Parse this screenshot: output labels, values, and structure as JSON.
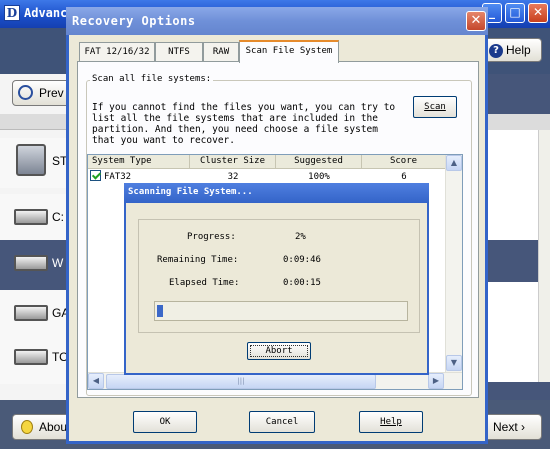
{
  "main_window": {
    "title": "Advanc",
    "icon_letter": "D",
    "help_label": "Help",
    "prev_label": "Prev",
    "about_label": "Abou",
    "next_label": "Next",
    "drives": [
      {
        "label": "ST"
      },
      {
        "label": "C:"
      },
      {
        "label": "W"
      },
      {
        "label": "GA"
      },
      {
        "label": "TO"
      }
    ]
  },
  "recovery_dialog": {
    "title": "Recovery Options",
    "tabs": [
      {
        "label": "FAT 12/16/32"
      },
      {
        "label": "NTFS"
      },
      {
        "label": "RAW"
      },
      {
        "label": "Scan File System"
      }
    ],
    "active_tab": "Scan File System",
    "group_title": "Scan all file systems:",
    "description": "If you cannot find the files you want, you can try to list all the file systems that are included in the partition. And then, you need choose a file system that you want to recover.",
    "scan_button": "Scan",
    "table": {
      "columns": [
        "System Type",
        "Cluster Size",
        "Suggested",
        "Score"
      ],
      "rows": [
        {
          "system_type": "FAT32",
          "cluster_size": "32",
          "suggested": "100%",
          "score": "6",
          "checked": true
        }
      ]
    },
    "ok_button": "OK",
    "cancel_button": "Cancel",
    "help_button": "Help"
  },
  "scanning_dialog": {
    "title": "Scanning File System...",
    "progress_label": "Progress:",
    "progress_value": "2%",
    "progress_fraction": 0.02,
    "remaining_label": "Remaining Time:",
    "remaining_value": "0:09:46",
    "elapsed_label": "Elapsed Time:",
    "elapsed_value": "0:00:15",
    "abort_button": "Abort"
  },
  "colors": {
    "titlebar_blue": "#1a4ec8",
    "dialog_face": "#ece9d8",
    "progress_fill": "#3b68c8",
    "active_tab_accent": "#e68b2c",
    "check_green": "#21a121"
  }
}
